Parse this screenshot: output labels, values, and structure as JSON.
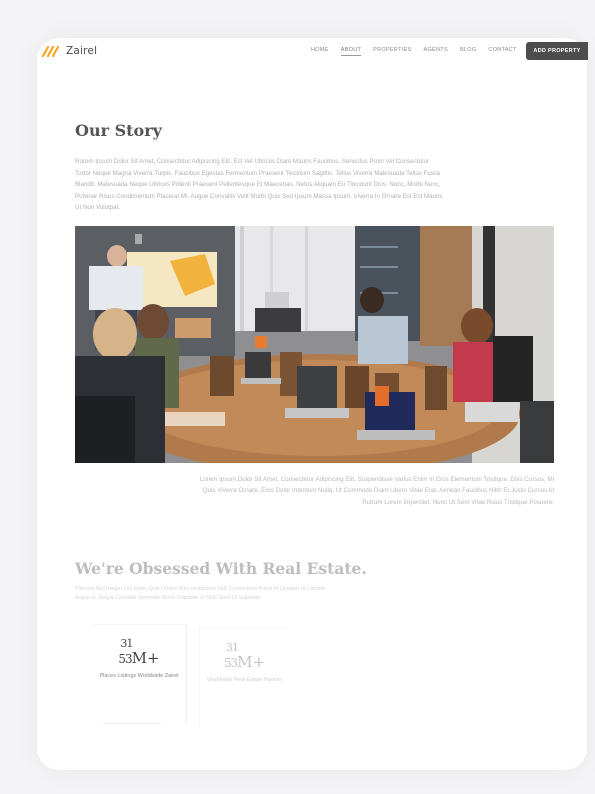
{
  "brand": {
    "name": "Zairel",
    "accent_color": "#f5a623"
  },
  "nav": {
    "items": [
      {
        "label": "HOME"
      },
      {
        "label": "ABOUT"
      },
      {
        "label": "PROPERTIES"
      },
      {
        "label": "AGENTS"
      },
      {
        "label": "BLOG"
      },
      {
        "label": "CONTACT"
      }
    ],
    "active": "ABOUT",
    "cta_label": "ADD PROPERTY"
  },
  "story": {
    "title": "Our Story",
    "text": "Rorem Ipsum Dolor Sit Amet, Consectetur Adipiscing Elit. Est Vel Ultrices Diam Mauris Faucibus. Senectus Proin Vel Consectetur Tortor Neque Magna Viverra Turpis. Faucibus Egestas Fermentum Praesent Tincidunt Sagittis. Tellus Viverra Malesuada Tellus Fusce Blandit. Malesuada Neque Ultrices Potenti Praesent Pellentesque Et Maecenas. Netus Aliquam Eu Tincidunt Duis. Nunc, Morbi Nunc, Pulvinar Risus Condimentum Placerat Mi. Augue Convallis Velit Morbi Quis Sed Ipsum Massa Ipsum. Viverra In Ornare Est Est Mauris Ut Non Volutpat.",
    "photo_icon": "meeting-photo",
    "caption": "Lorem Ipsum Dolor Sit Amet, Consectetur Adipiscing Elit. Suspendisse Varius Enim In Eros Elementum Tristique. Duis Cursus, Mi Quis Viverra Ornare, Eros Dolor Interdum Nulla, Ut Commodo Diam Libero Vitae Erat. Aenean Faucibus Nibh Et Justo Cursus Id Rutrum Lorem Imperdiet. Nunc Ut Sem Vitae Risus Tristique Posuere."
  },
  "obsessed": {
    "title": "We're Obsessed With Real Estate.",
    "text": "Placerat Sed Integer Leo Diam, Quis Ornare Duis Vestibulum Sed. Consectetur Purus At Quisque Ut Laoreet Augue In. Neque Convallis Venenatis Morbi Vulputate Ut Nibh Diam Ut Vulputate."
  },
  "stats": [
    {
      "top_digits": "31",
      "bottom_digits": "53",
      "suffix": "M+",
      "label": "Places Listings Worldwide Zairel"
    },
    {
      "top_digits": "31",
      "bottom_digits": "53",
      "suffix": "M+",
      "label": "Worldwide Real Estate Partner"
    }
  ]
}
